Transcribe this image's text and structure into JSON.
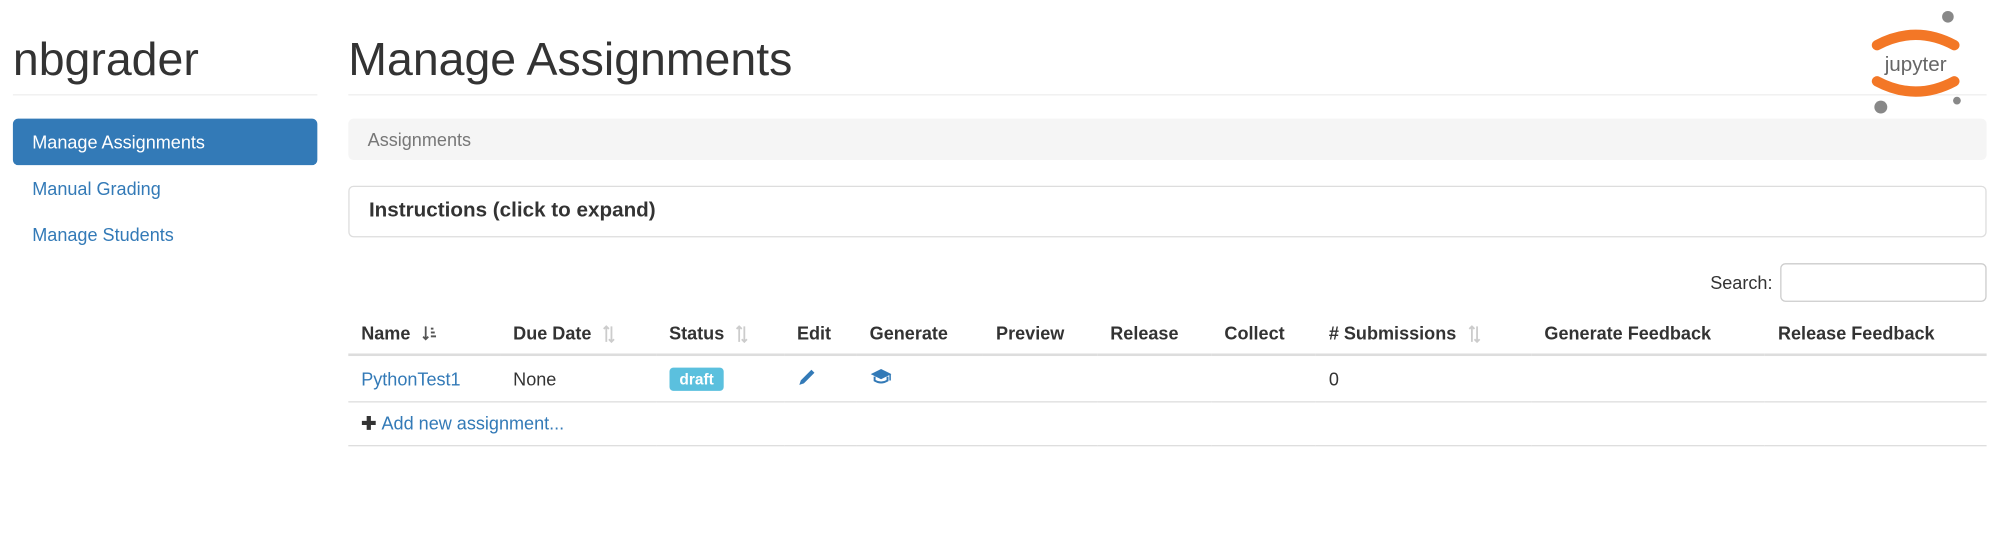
{
  "app_title": "nbgrader",
  "page_title": "Manage Assignments",
  "logo_text": "jupyter",
  "sidebar": {
    "items": [
      {
        "label": "Manage Assignments",
        "active": true
      },
      {
        "label": "Manual Grading",
        "active": false
      },
      {
        "label": "Manage Students",
        "active": false
      }
    ]
  },
  "breadcrumb": "Assignments",
  "instructions_panel": "Instructions (click to expand)",
  "search_label": "Search:",
  "search_value": "",
  "columns": {
    "name": "Name",
    "due_date": "Due Date",
    "status": "Status",
    "edit": "Edit",
    "generate": "Generate",
    "preview": "Preview",
    "release": "Release",
    "collect": "Collect",
    "submissions": "# Submissions",
    "gen_feedback": "Generate Feedback",
    "rel_feedback": "Release Feedback"
  },
  "rows": [
    {
      "name": "PythonTest1",
      "due_date": "None",
      "status": "draft",
      "submissions": "0"
    }
  ],
  "add_new_label": "Add new assignment..."
}
